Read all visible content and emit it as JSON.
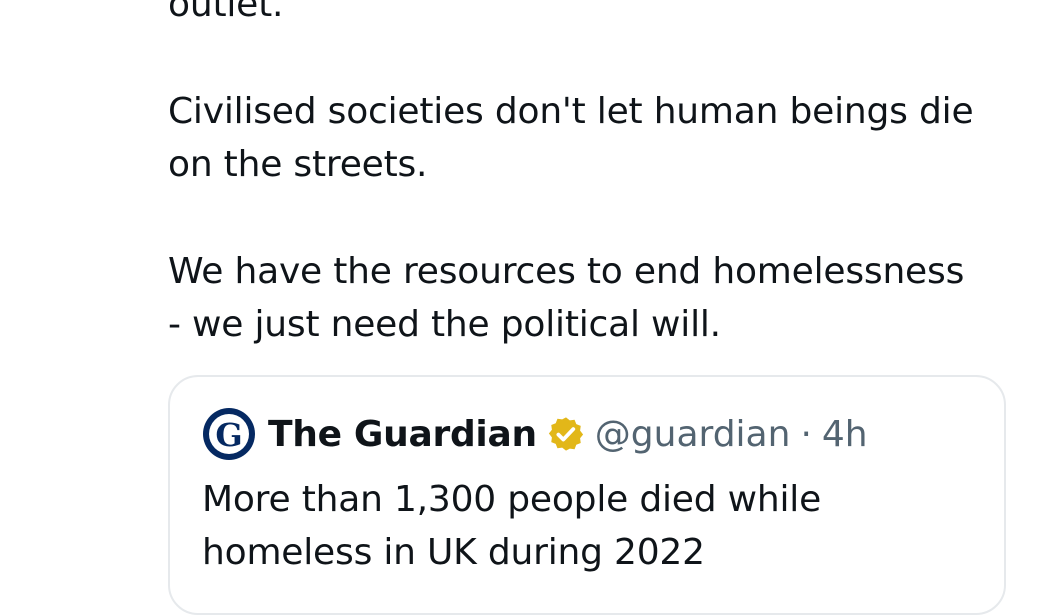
{
  "tweet": {
    "paragraphs": [
      "outlet.",
      "Civilised societies don't let human beings die\non the streets.",
      "We have the resources to end homelessness\n- we just need the political will."
    ]
  },
  "quote": {
    "author_name": "The Guardian",
    "handle": "@guardian",
    "separator": "·",
    "time": "4h",
    "text": "More than 1,300 people died while\nhomeless in UK during 2022",
    "avatar_letter": "G",
    "avatar_color": "#052962",
    "verified_color": "#e2b719"
  }
}
